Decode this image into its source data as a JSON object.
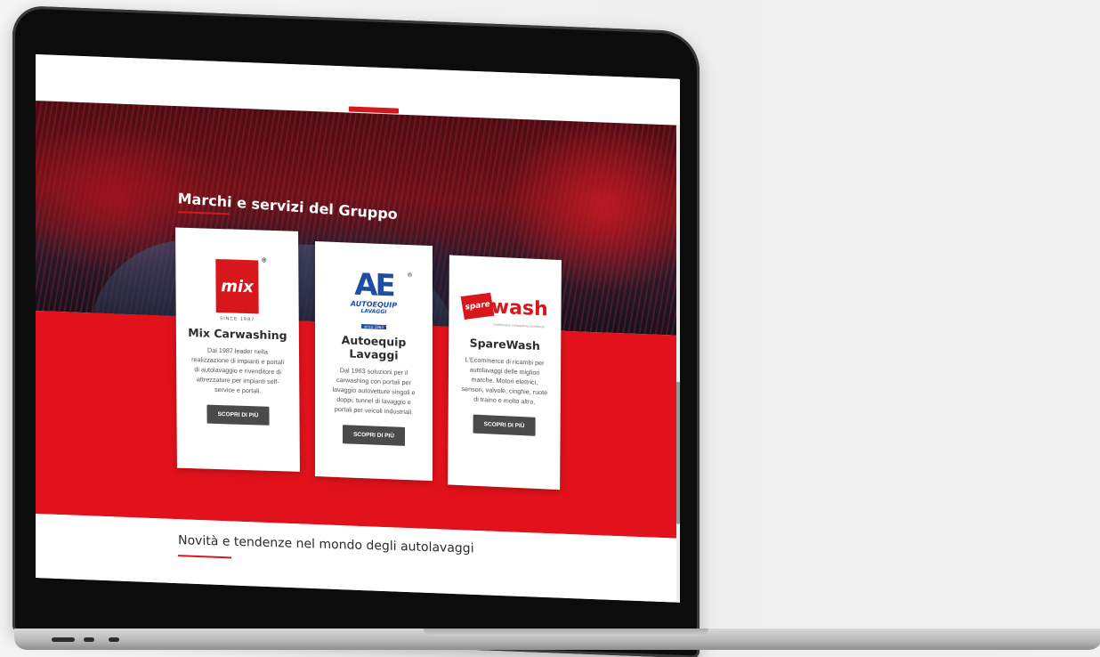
{
  "section": {
    "title": "Marchi e servizi del Gruppo"
  },
  "cards": [
    {
      "logo_text": "mix",
      "logo_reg": "®",
      "logo_since": "SINCE 1987",
      "title": "Mix Carwashing",
      "description": "Dal 1987 leader nella realizzazione di impianti e portali di autolavaggio e rivenditore di attrezzature per impianti self-service e portali.",
      "button": "SCOPRI DI PIÙ"
    },
    {
      "logo_mark_a": "A",
      "logo_mark_e": "E",
      "logo_line1": "AUTOEQUIP",
      "logo_line2": "LAVAGGI",
      "logo_line3": "since 1963",
      "logo_reg": "®",
      "title": "Autoequip Lavaggi",
      "description": "Dal 1963 soluzioni per il carwashing con portali per lavaggio autovetture singoli e doppi, tunnel di lavaggio e portali per veicoli industriali.",
      "button": "SCOPRI DI PIÙ"
    },
    {
      "logo_spare": "spare",
      "logo_wash": "wash",
      "logo_tag": "multibrand carwashing solutions",
      "title": "SpareWash",
      "description": "L'Ecommerce di ricambi per autolavaggi delle migliori marche. Motori elettrici, sensori, valvole, cinghie, ruote di traino e molto altro.",
      "button": "SCOPRI DI PIÙ"
    }
  ],
  "news": {
    "title": "Novità e tendenze nel mondo degli autolavaggi"
  },
  "colors": {
    "brand_red": "#e1121b",
    "button_dark": "#4a4a4a",
    "autoequip_blue": "#1a4fa3"
  }
}
